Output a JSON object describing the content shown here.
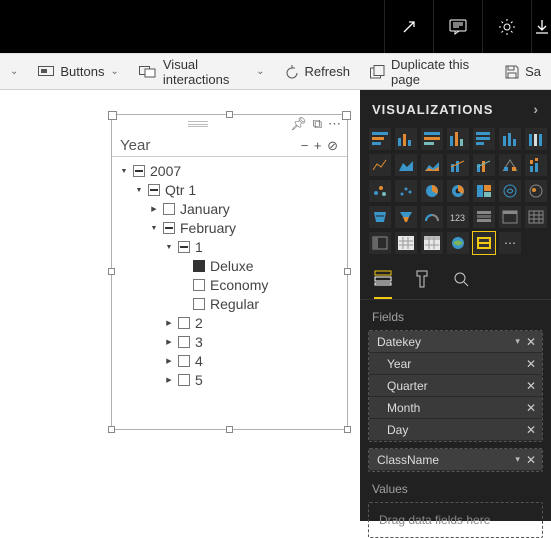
{
  "topbar": {
    "icons": [
      "expand-icon",
      "comment-icon",
      "gear-icon",
      "download-icon"
    ]
  },
  "ribbon": {
    "left_chev": "⌄",
    "buttons": {
      "label": "Buttons"
    },
    "interactions": {
      "label": "Visual interactions"
    },
    "refresh": {
      "label": "Refresh"
    },
    "duplicate": {
      "label": "Duplicate this page"
    },
    "save": {
      "label": "Sa"
    }
  },
  "slicer": {
    "title": "Year",
    "controls": "− + ⊘",
    "tree": [
      {
        "indent": 0,
        "toggle": "▾",
        "box": "dash",
        "label": "2007"
      },
      {
        "indent": 1,
        "toggle": "▾",
        "box": "dash",
        "label": "Qtr 1"
      },
      {
        "indent": 2,
        "toggle": "▸",
        "box": "empty",
        "label": "January"
      },
      {
        "indent": 2,
        "toggle": "▾",
        "box": "dash",
        "label": "February"
      },
      {
        "indent": 3,
        "toggle": "▾",
        "box": "dash",
        "label": "1"
      },
      {
        "indent": 4,
        "toggle": "",
        "box": "filled",
        "label": "Deluxe"
      },
      {
        "indent": 4,
        "toggle": "",
        "box": "empty",
        "label": "Economy"
      },
      {
        "indent": 4,
        "toggle": "",
        "box": "empty",
        "label": "Regular"
      },
      {
        "indent": 3,
        "toggle": "▸",
        "box": "empty",
        "label": "2"
      },
      {
        "indent": 3,
        "toggle": "▸",
        "box": "empty",
        "label": "3"
      },
      {
        "indent": 3,
        "toggle": "▸",
        "box": "empty",
        "label": "4"
      },
      {
        "indent": 3,
        "toggle": "▸",
        "box": "empty",
        "label": "5"
      }
    ]
  },
  "panel": {
    "title": "VISUALIZATIONS",
    "fields_label": "Fields",
    "values_label": "Values",
    "placeholder": "Drag data fields here",
    "field_wells": [
      {
        "name": "Datekey",
        "head": true
      },
      {
        "name": "Year"
      },
      {
        "name": "Quarter"
      },
      {
        "name": "Month"
      },
      {
        "name": "Day"
      }
    ],
    "field_wells2": [
      {
        "name": "ClassName",
        "head": true
      }
    ]
  }
}
